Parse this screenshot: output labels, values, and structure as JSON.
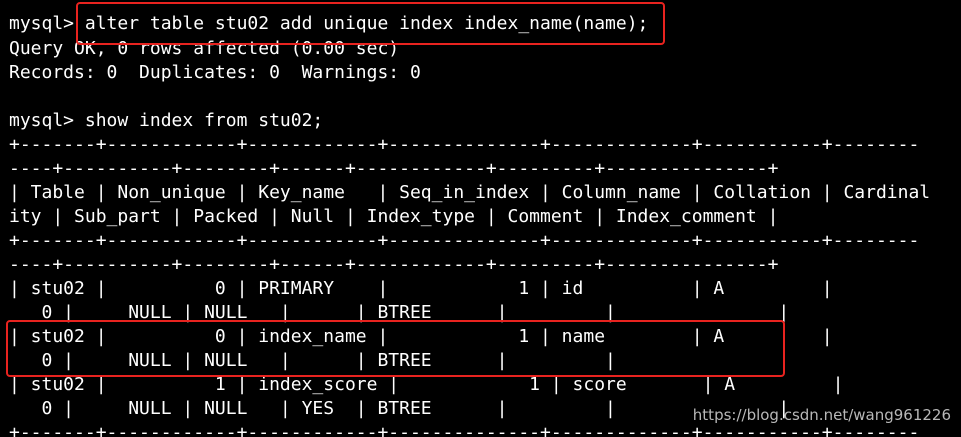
{
  "terminal": {
    "lines": [
      "mysql> alter table stu02 add unique index index_name(name);",
      "Query OK, 0 rows affected (0.00 sec)",
      "Records: 0  Duplicates: 0  Warnings: 0",
      "",
      "mysql> show index from stu02;",
      "+-------+------------+------------+--------------+-------------+-----------+--------",
      "----+----------+--------+------+------------+---------+---------------+",
      "| Table | Non_unique | Key_name   | Seq_in_index | Column_name | Collation | Cardinal",
      "ity | Sub_part | Packed | Null | Index_type | Comment | Index_comment |",
      "+-------+------------+------------+--------------+-------------+-----------+--------",
      "----+----------+--------+------+------------+---------+---------------+",
      "| stu02 |          0 | PRIMARY    |            1 | id          | A         |",
      "   0 |     NULL | NULL   |      | BTREE      |         |               |",
      "| stu02 |          0 | index_name |            1 | name        | A         |",
      "   0 |     NULL | NULL   |      | BTREE      |         |               |",
      "| stu02 |          1 | index_score |            1 | score       | A         |",
      "   0 |     NULL | NULL   | YES  | BTREE      |         |               |",
      "+-------+------------+------------+--------------+-------------+-----------+--------"
    ]
  },
  "watermark": "https://blog.csdn.net/wang961226",
  "colors": {
    "background": "#000000",
    "text": "#ffffff",
    "highlight": "#e8231f"
  }
}
